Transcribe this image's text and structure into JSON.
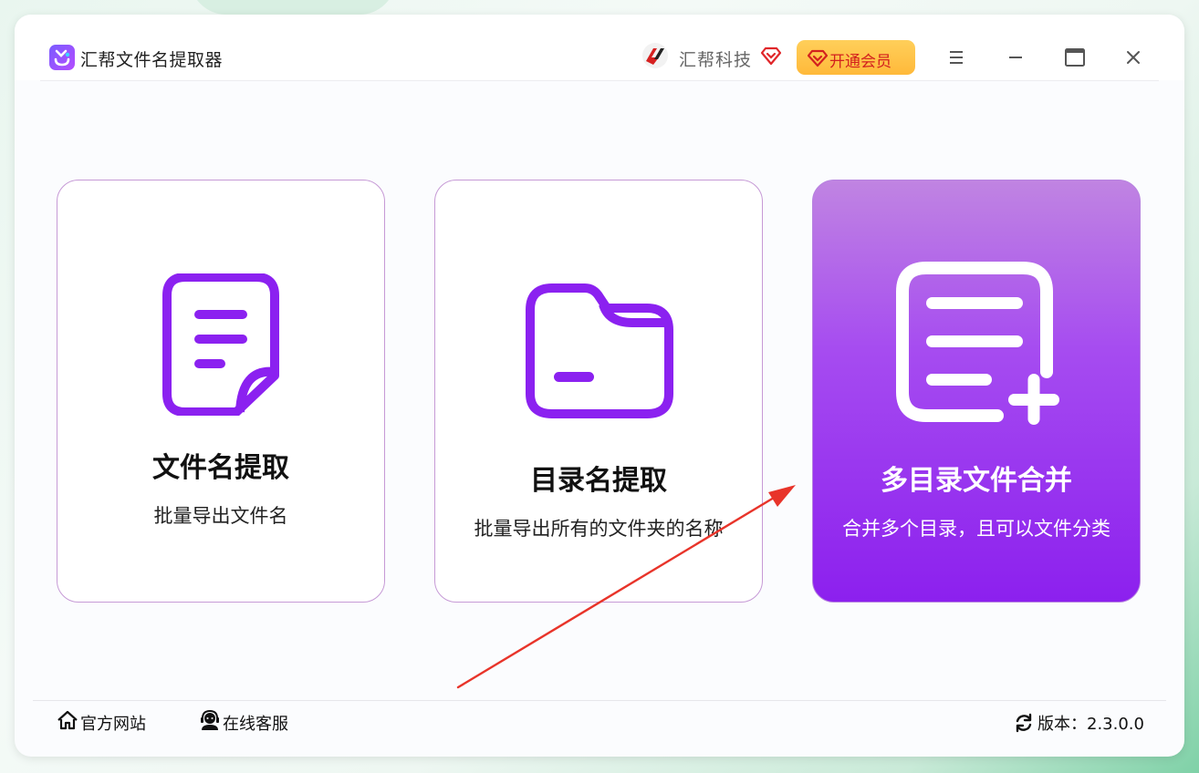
{
  "app": {
    "title": "汇帮文件名提取器"
  },
  "header": {
    "brand_name": "汇帮科技",
    "vip_label": "开通会员"
  },
  "colors": {
    "accent": "#8c20ee",
    "card_border": "#c69ad6",
    "vip": "#ffbf40",
    "vip_text": "#d3211e"
  },
  "cards": [
    {
      "title": "文件名提取",
      "subtitle": "批量导出文件名",
      "icon": "file-icon"
    },
    {
      "title": "目录名提取",
      "subtitle": "批量导出所有的文件夹的名称",
      "icon": "folder-icon"
    },
    {
      "title": "多目录文件合并",
      "subtitle": "合并多个目录，且可以文件分类",
      "icon": "list-add-icon"
    }
  ],
  "footer": {
    "website_label": "官方网站",
    "support_label": "在线客服",
    "version_label": "版本：2.3.0.0"
  }
}
